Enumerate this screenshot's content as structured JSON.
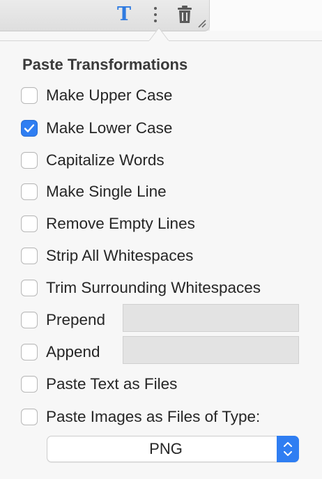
{
  "toolbar": {
    "text_icon": "T",
    "more_icon": "more-vertical-icon",
    "trash_icon": "trash-icon",
    "resize_icon": "resize-grip-icon"
  },
  "popover": {
    "title": "Paste Transformations",
    "options": [
      {
        "label": "Make Upper Case",
        "checked": false
      },
      {
        "label": "Make Lower Case",
        "checked": true
      },
      {
        "label": "Capitalize Words",
        "checked": false
      },
      {
        "label": "Make Single Line",
        "checked": false
      },
      {
        "label": "Remove Empty Lines",
        "checked": false
      },
      {
        "label": "Strip All Whitespaces",
        "checked": false
      },
      {
        "label": "Trim Surrounding Whitespaces",
        "checked": false
      },
      {
        "label": "Prepend",
        "checked": false
      },
      {
        "label": "Append",
        "checked": false
      },
      {
        "label": "Paste Text as Files",
        "checked": false
      },
      {
        "label": "Paste Images as Files of Type:",
        "checked": false
      }
    ],
    "prepend_value": "",
    "append_value": "",
    "image_type": {
      "selected": "PNG"
    }
  },
  "colors": {
    "accent": "#2f7ef2",
    "text_icon": "#2f7be0"
  }
}
